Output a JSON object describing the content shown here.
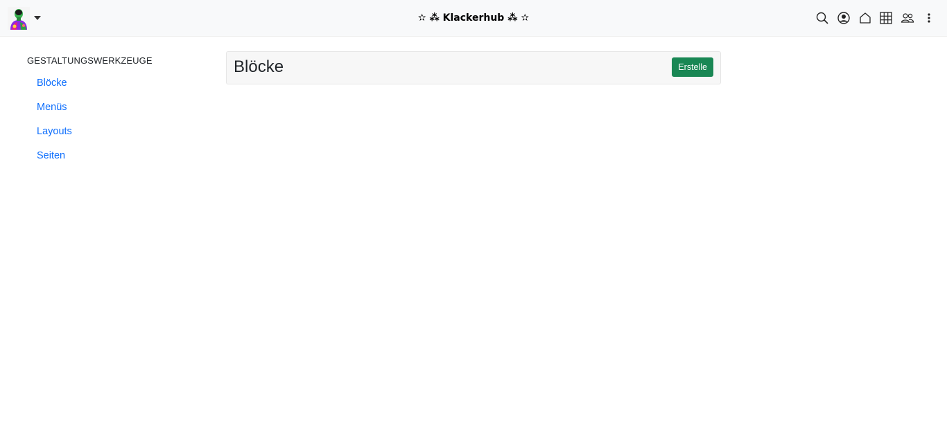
{
  "header": {
    "brand_title": "✫ ⁂ Klackerhub ⁂ ✫",
    "avatar_icon": "user-avatar",
    "menu_caret_icon": "caret-down-icon",
    "icons": [
      "search-icon",
      "user-circle-icon",
      "home-icon",
      "grid-icon",
      "people-icon",
      "more-vertical-icon"
    ]
  },
  "sidebar": {
    "heading": "Gestaltungswerkzeuge",
    "items": [
      {
        "label": "Blöcke"
      },
      {
        "label": "Menüs"
      },
      {
        "label": "Layouts"
      },
      {
        "label": "Seiten"
      }
    ]
  },
  "main": {
    "title": "Blöcke",
    "create_label": "Erstelle"
  },
  "colors": {
    "accent_link": "#0d6efd",
    "create_button": "#198754",
    "navbar_bg": "#f8f9fa"
  }
}
